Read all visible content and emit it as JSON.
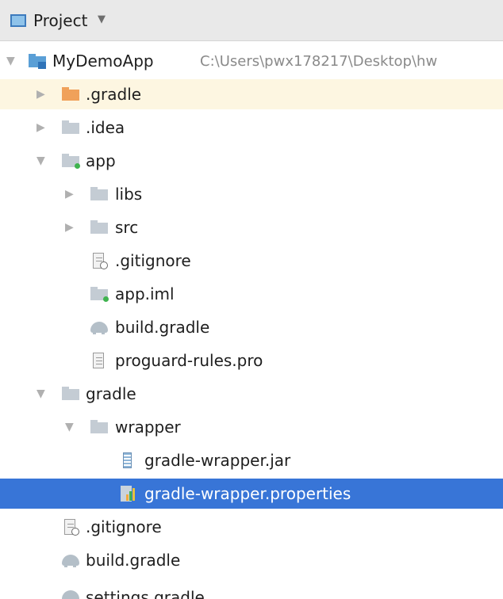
{
  "header": {
    "title": "Project",
    "caret": "▼"
  },
  "tree": {
    "items": [
      {
        "label": "MyDemoApp",
        "path": "C:\\Users\\pwx178217\\Desktop\\hw"
      },
      {
        "label": ".gradle"
      },
      {
        "label": ".idea"
      },
      {
        "label": "app"
      },
      {
        "label": "libs"
      },
      {
        "label": "src"
      },
      {
        "label": ".gitignore"
      },
      {
        "label": "app.iml"
      },
      {
        "label": "build.gradle"
      },
      {
        "label": "proguard-rules.pro"
      },
      {
        "label": "gradle"
      },
      {
        "label": "wrapper"
      },
      {
        "label": "gradle-wrapper.jar"
      },
      {
        "label": "gradle-wrapper.properties"
      },
      {
        "label": ".gitignore"
      },
      {
        "label": "build.gradle"
      },
      {
        "label": "settings.gradle"
      }
    ]
  },
  "colors": {
    "selection": "#3875d7",
    "highlight_row": "#fdf6e1",
    "header_bg": "#e9e9e9",
    "folder_gray": "#c4ccd4",
    "folder_orange": "#f0a15a",
    "module_dot": "#3fb34f"
  }
}
